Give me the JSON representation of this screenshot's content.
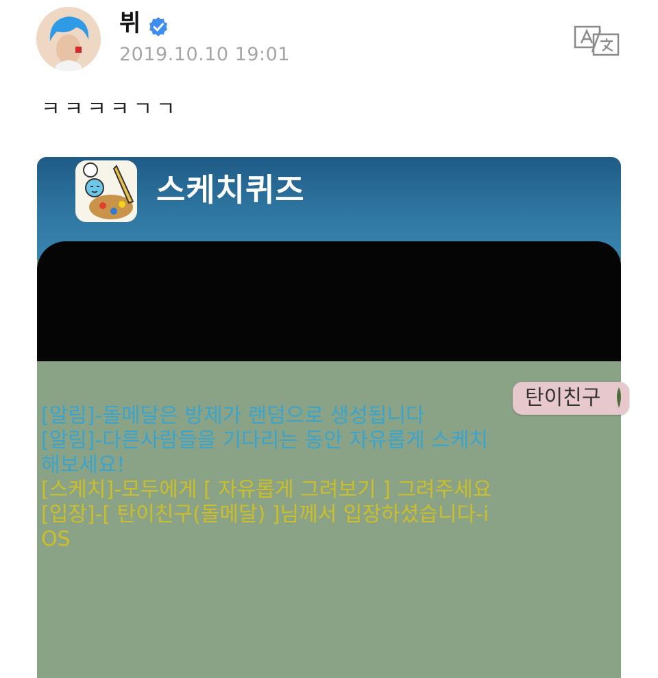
{
  "header": {
    "username": "뷔",
    "timestamp": "2019.10.10 19:01",
    "verified_color": "#3d8ef0",
    "avatar_icon": "avatar-blue-hair-icon",
    "translate_icon": "translate-icon"
  },
  "post": {
    "text": "ㅋㅋㅋㅋㄱㄱ"
  },
  "media": {
    "app_name": "스케치퀴즈",
    "app_icon": "sketch-quiz-app-icon",
    "user_tag": "탄이친구",
    "chat_lines": [
      "[알림]-돌메달은 방제가 랜덤으로 생성됩니다",
      "[알림]-다른사람들을 기다리는 동안 자유롭게 스케치",
      "해보세요!",
      "[스케치]-모두에게 [ 자유롭게 그려보기 ] 그려주세요",
      "[입장]-[ 탄이친구(돌메달) ]님께서 입장하셨습니다-i",
      "OS"
    ],
    "colors": {
      "header_blue": "#2d75a0",
      "chat_bg": "#8aa386",
      "notice_text": "#3aa4cc",
      "entry_text": "#cbbe2a"
    }
  }
}
